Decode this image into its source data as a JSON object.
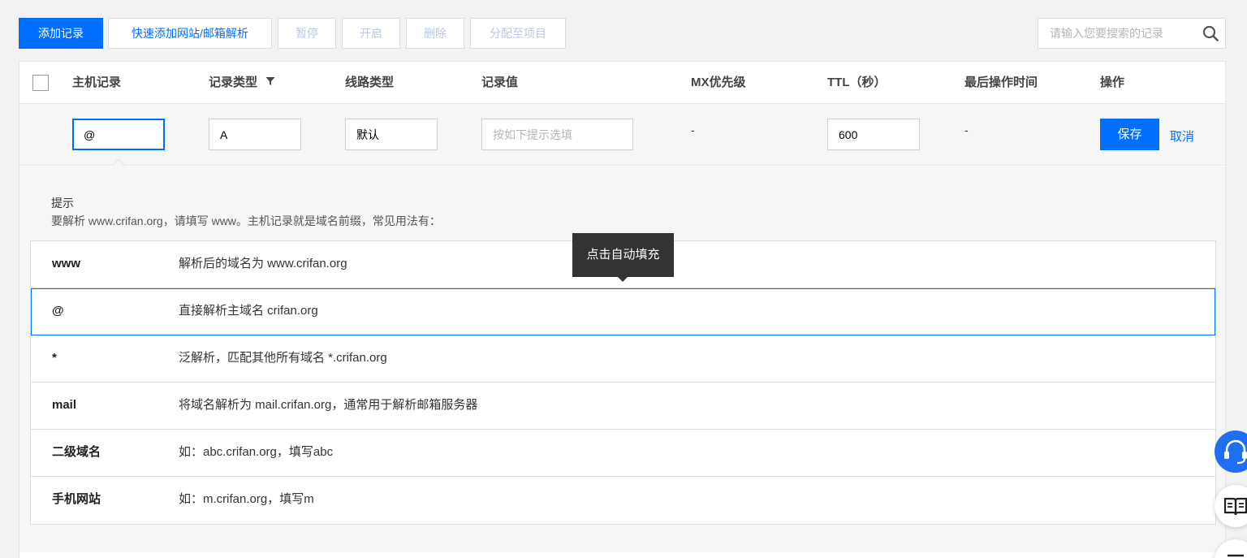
{
  "toolbar": {
    "add_record": "添加记录",
    "quick_add": "快速添加网站/邮箱解析",
    "pause": "暂停",
    "enable": "开启",
    "delete": "删除",
    "assign_project": "分配至项目",
    "search_placeholder": "请输入您要搜索的记录"
  },
  "table": {
    "columns": [
      "主机记录",
      "记录类型",
      "线路类型",
      "记录值",
      "MX优先级",
      "TTL（秒）",
      "最后操作时间",
      "操作"
    ]
  },
  "edit_row": {
    "host": "@",
    "type": "A",
    "line": "默认",
    "value_placeholder": "按如下提示选填",
    "mx": "-",
    "ttl": "600",
    "last_op": "-",
    "save": "保存",
    "cancel": "取消"
  },
  "tips": {
    "title": "提示",
    "desc": "要解析 www.crifan.org，请填写 www。主机记录就是域名前缀，常见用法有：",
    "rows": [
      {
        "key": "www",
        "value": "解析后的域名为 www.crifan.org"
      },
      {
        "key": "@",
        "value": "直接解析主域名 crifan.org"
      },
      {
        "key": "*",
        "value": "泛解析，匹配其他所有域名 *.crifan.org"
      },
      {
        "key": "mail",
        "value": "将域名解析为 mail.crifan.org，通常用于解析邮箱服务器"
      },
      {
        "key": "二级域名",
        "value": "如：abc.crifan.org，填写abc"
      },
      {
        "key": "手机网站",
        "value": "如：m.crifan.org，填写m"
      }
    ],
    "active_row": 1
  },
  "tooltip": "点击自动填充",
  "colors": {
    "primary": "#006eff",
    "disabled_text": "#b8c9e4",
    "tooltip_bg": "#333333"
  },
  "floating": {
    "service_icon": "headset-icon",
    "docs_icon": "book-icon",
    "more_icon": "menu-icon"
  }
}
